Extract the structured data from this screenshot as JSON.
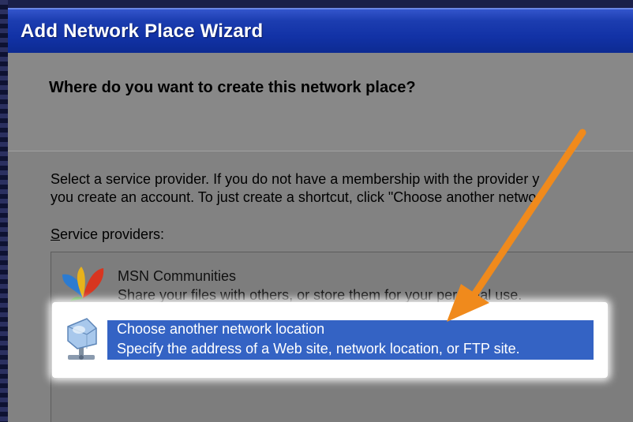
{
  "window": {
    "title": "Add Network Place Wizard"
  },
  "header": {
    "title": "Where do you want to create this network place?"
  },
  "content": {
    "description_line1": "Select a service provider.  If you do not have a membership with the provider y",
    "description_line2": "you create an account.  To just create a shortcut, click \"Choose another netwo",
    "service_providers_label_underlined": "S",
    "service_providers_label_rest": "ervice providers:"
  },
  "service_providers": [
    {
      "title": "MSN Communities",
      "description": "Share your files with others, or store them for your personal use.",
      "icon": "msn-butterfly-icon",
      "selected": false
    },
    {
      "title": "Choose another network location",
      "description": "Specify the address of a Web site, network location, or FTP site.",
      "icon": "network-location-icon",
      "selected": true
    }
  ],
  "colors": {
    "titlebar": "#1232a6",
    "selection": "#3463c4",
    "arrow": "#f08a1c"
  }
}
